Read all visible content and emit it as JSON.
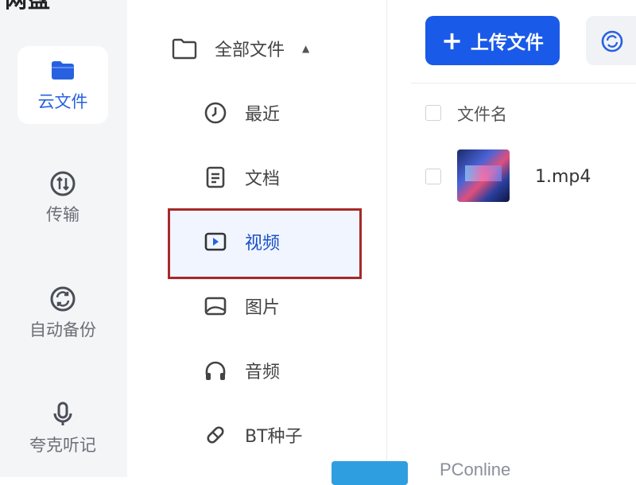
{
  "app": {
    "brand": "网盘"
  },
  "rail": {
    "items": [
      {
        "label": "云文件",
        "icon": "folder-icon",
        "active": true
      },
      {
        "label": "传输",
        "icon": "transfer-icon"
      },
      {
        "label": "自动备份",
        "icon": "backup-sync-icon"
      },
      {
        "label": "夸克听记",
        "icon": "microphone-icon"
      }
    ]
  },
  "nav": {
    "header": {
      "label": "全部文件",
      "icon": "folder-outline-icon",
      "caret": "▲"
    },
    "items": [
      {
        "label": "最近",
        "icon": "clock-icon"
      },
      {
        "label": "文档",
        "icon": "document-icon"
      },
      {
        "label": "视频",
        "icon": "video-play-icon",
        "active": true
      },
      {
        "label": "图片",
        "icon": "image-icon"
      },
      {
        "label": "音频",
        "icon": "headphones-icon"
      },
      {
        "label": "BT种子",
        "icon": "bt-seed-icon"
      }
    ]
  },
  "toolbar": {
    "upload_label": "上传文件",
    "upload_icon": "plus-icon",
    "sync_icon": "sync-icon"
  },
  "file_list": {
    "column_header": "文件名",
    "files": [
      {
        "name": "1.mp4",
        "thumbnail": "video-thumbnail"
      }
    ]
  },
  "watermark": {
    "text": "PConline"
  },
  "colors": {
    "accent": "#1a5ae8",
    "highlight_border": "#a82828",
    "rail_bg": "#f4f5f7"
  }
}
